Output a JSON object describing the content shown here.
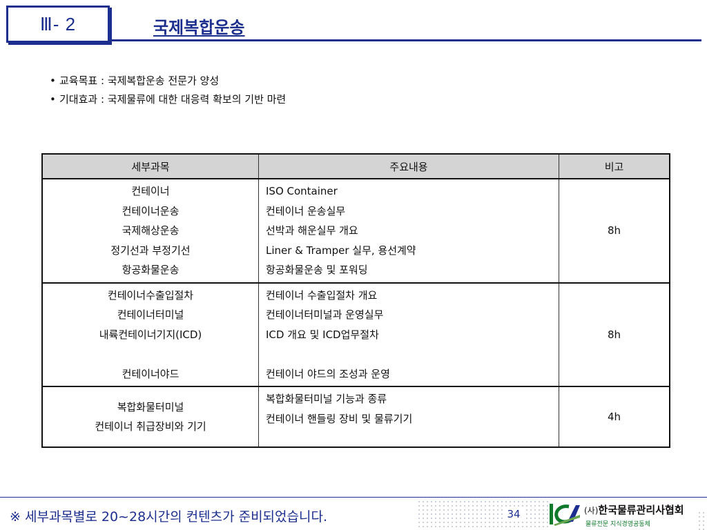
{
  "header": {
    "section_number": "Ⅲ- 2",
    "title": "국제복합운송"
  },
  "bullets": [
    "교육목표 : 국제복합운송 전문가 양성",
    "기대효과 : 국제물류에 대한 대응력 확보의 기반 마련"
  ],
  "table": {
    "headers": [
      "세부과목",
      "주요내용",
      "비고"
    ],
    "rows": [
      {
        "subjects": [
          "컨테이너",
          "컨테이너운송",
          "국제해상운송",
          "정기선과 부정기선",
          "항공화물운송"
        ],
        "contents": [
          "ISO Container",
          "컨테이너 운송실무",
          "선박과 해운실무 개요",
          "Liner & Tramper 실무, 용선계약",
          "항공화물운송 및 포워딩"
        ],
        "note": "8h"
      },
      {
        "subjects": [
          "컨테이너수출입절차",
          "컨테이너터미널",
          "내륙컨테이너기지(ICD)",
          "",
          "컨테이너야드"
        ],
        "contents": [
          "컨테이너 수출입절차 개요",
          "컨테이너터미널과 운영실무",
          "ICD 개요 및 ICD업무절차",
          "",
          "컨테이너 야드의 조성과 운영"
        ],
        "note": "8h"
      },
      {
        "subjects": [
          "복합화물터미널",
          "컨테이너 취급장비와 기기"
        ],
        "contents": [
          "복합화물터미널 기능과 종류",
          "컨테이너 핸들링 장비 및 물류기기"
        ],
        "note": "4h"
      }
    ]
  },
  "footer": {
    "note": "※ 세부과목별로 20~28시간의 컨텐츠가 준비되었습니다.",
    "page_number": "34",
    "org_prefix": "(사)",
    "org_name": "한국물류관리사협회",
    "org_slogan": "물류전문  지식경영공동체"
  },
  "colors": {
    "brand_navy": "#1c2f8f",
    "header_gray": "#d4d4d4",
    "logo_green": "#0f7a2c"
  }
}
